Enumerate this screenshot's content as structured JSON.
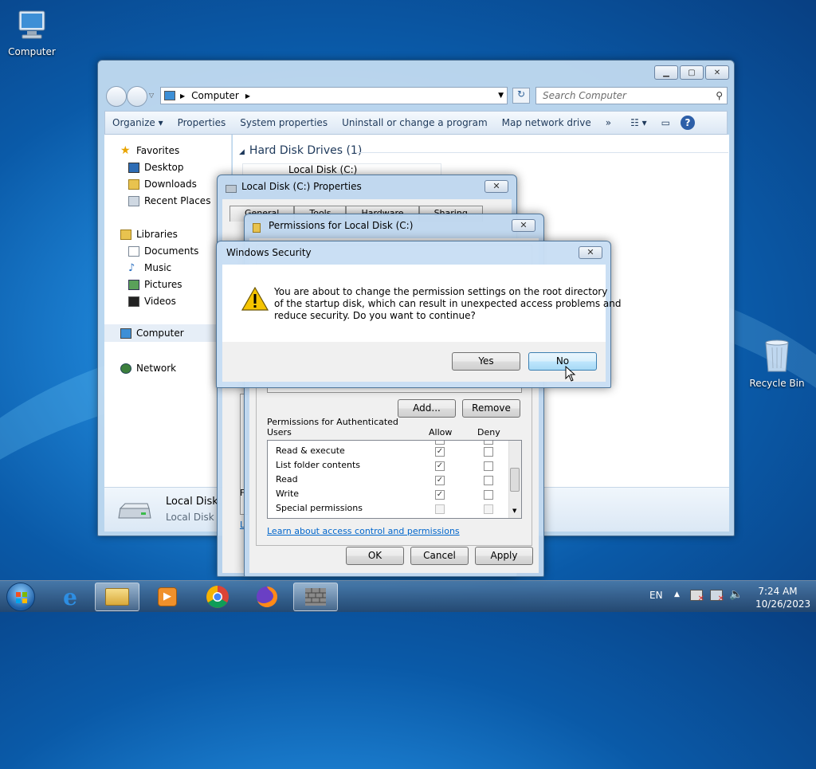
{
  "desktop": {
    "icons": [
      {
        "label": "Computer"
      },
      {
        "label": "Recycle Bin"
      }
    ]
  },
  "explorer": {
    "address": "Computer",
    "search_placeholder": "Search Computer",
    "commands": [
      "Organize",
      "Properties",
      "System properties",
      "Uninstall or change a program",
      "Map network drive",
      "»"
    ],
    "nav": {
      "favorites": "Favorites",
      "favorites_items": [
        "Desktop",
        "Downloads",
        "Recent Places"
      ],
      "libraries": "Libraries",
      "libraries_items": [
        "Documents",
        "Music",
        "Pictures",
        "Videos"
      ],
      "computer": "Computer",
      "network": "Network"
    },
    "section_header": "Hard Disk Drives (1)",
    "drive_label": "Local Disk (C:)",
    "details_name": "Local Disk (",
    "details_type": "Local Disk"
  },
  "properties_dialog": {
    "title": "Local Disk (C:) Properties",
    "tabs": [
      "General",
      "Tools",
      "Hardware",
      "Sharing"
    ],
    "left_letter_f": "F",
    "left_letter_l": "L"
  },
  "permissions_dialog": {
    "title": "Permissions for Local Disk (C:)",
    "add_label": "Add...",
    "remove_label": "Remove",
    "perms_header_line1": "Permissions for Authenticated",
    "perms_header_line2": "Users",
    "allow_label": "Allow",
    "deny_label": "Deny",
    "rows": [
      {
        "name": "Read & execute",
        "allow": true,
        "deny": false
      },
      {
        "name": "List folder contents",
        "allow": true,
        "deny": false
      },
      {
        "name": "Read",
        "allow": true,
        "deny": false
      },
      {
        "name": "Write",
        "allow": true,
        "deny": false
      },
      {
        "name": "Special permissions",
        "allow": false,
        "deny": false
      }
    ],
    "link": "Learn about access control and permissions",
    "ok_label": "OK",
    "cancel_label": "Cancel",
    "apply_label": "Apply"
  },
  "security_dialog": {
    "title": "Windows Security",
    "message_line1": "You are about to change the permission settings on the root directory",
    "message_line2": "of the startup disk, which can result in unexpected access problems and",
    "message_line3": "reduce security. Do you want to continue?",
    "yes_label": "Yes",
    "no_label": "No"
  },
  "taskbar": {
    "items": [
      "start-orb",
      "internet-explorer",
      "windows-explorer",
      "media-player",
      "chrome",
      "firefox",
      "security-app"
    ],
    "language": "EN",
    "time": "7:24 AM",
    "date": "10/26/2023"
  }
}
